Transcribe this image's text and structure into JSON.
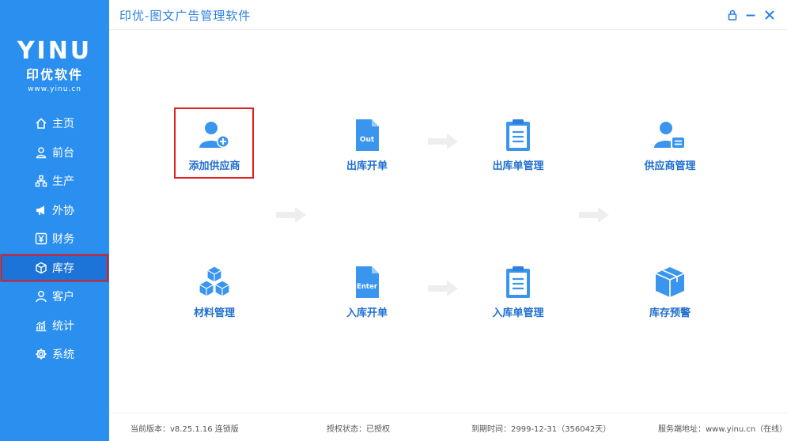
{
  "app": {
    "title": "印优-图文广告管理软件",
    "logo_mark": "YINU",
    "logo_name": "印优软件",
    "logo_url": "www.yinu.cn"
  },
  "sidebar": {
    "items": [
      {
        "label": "主页",
        "icon": "home-icon"
      },
      {
        "label": "前台",
        "icon": "user-desk-icon"
      },
      {
        "label": "生产",
        "icon": "org-chart-icon"
      },
      {
        "label": "外协",
        "icon": "megaphone-icon"
      },
      {
        "label": "财务",
        "icon": "yuan-icon"
      },
      {
        "label": "库存",
        "icon": "box-icon",
        "active": true
      },
      {
        "label": "客户",
        "icon": "person-icon"
      },
      {
        "label": "统计",
        "icon": "chart-icon"
      },
      {
        "label": "系统",
        "icon": "gear-icon"
      }
    ]
  },
  "window": {
    "lock_icon": "lock-icon",
    "minimize_icon": "minimize-icon",
    "close_icon": "close-icon"
  },
  "workflow": {
    "add_supplier": "添加供应商",
    "outbound_create": "出库开单",
    "outbound_label_badge": "Out",
    "outbound_manage": "出库单管理",
    "supplier_manage": "供应商管理",
    "material_manage": "材料管理",
    "inbound_create": "入库开单",
    "inbound_label_badge": "Enter",
    "inbound_manage": "入库单管理",
    "stock_warning": "库存预警"
  },
  "colors": {
    "sidebar": "#2b8ff0",
    "accent": "#2b7fe0",
    "icon": "#3a95ee",
    "highlight": "#e02020"
  },
  "footer": {
    "version": "当前版本：v8.25.1.16  连锁版",
    "auth": "授权状态：已授权",
    "expire": "到期时间：2999-12-31（356042天）",
    "server": "服务端地址：www.yinu.cn（在线）"
  }
}
